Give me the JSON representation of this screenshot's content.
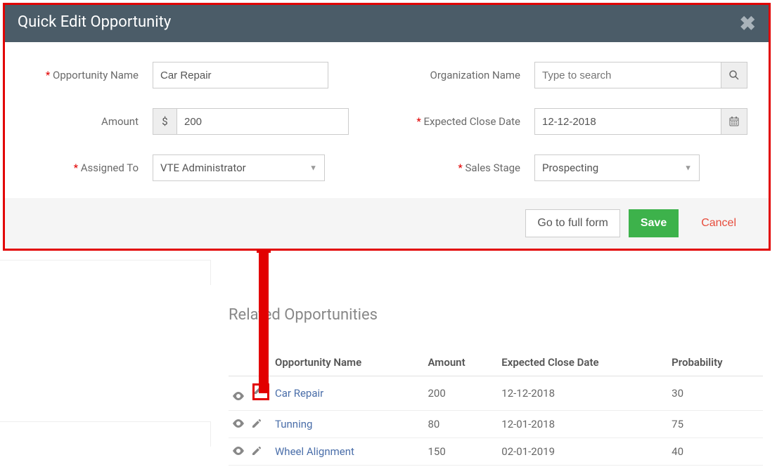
{
  "modal": {
    "title": "Quick Edit Opportunity",
    "fields": {
      "opportunity_name": {
        "label": "Opportunity Name",
        "value": "Car Repair"
      },
      "organization_name": {
        "label": "Organization Name",
        "placeholder": "Type to search"
      },
      "amount": {
        "label": "Amount",
        "currency": "$",
        "value": "200"
      },
      "expected_close_date": {
        "label": "Expected Close Date",
        "value": "12-12-2018"
      },
      "assigned_to": {
        "label": "Assigned To",
        "value": "VTE Administrator"
      },
      "sales_stage": {
        "label": "Sales Stage",
        "value": "Prospecting"
      }
    },
    "buttons": {
      "full_form": "Go to full form",
      "save": "Save",
      "cancel": "Cancel"
    }
  },
  "related": {
    "title": "Related Opportunities",
    "columns": {
      "name": "Opportunity Name",
      "amount": "Amount",
      "close": "Expected Close Date",
      "prob": "Probability"
    },
    "rows": [
      {
        "name": "Car Repair",
        "amount": "200",
        "close": "12-12-2018",
        "prob": "30"
      },
      {
        "name": "Tunning",
        "amount": "80",
        "close": "12-01-2018",
        "prob": "75"
      },
      {
        "name": "Wheel Alignment",
        "amount": "150",
        "close": "02-01-2019",
        "prob": "40"
      }
    ]
  }
}
